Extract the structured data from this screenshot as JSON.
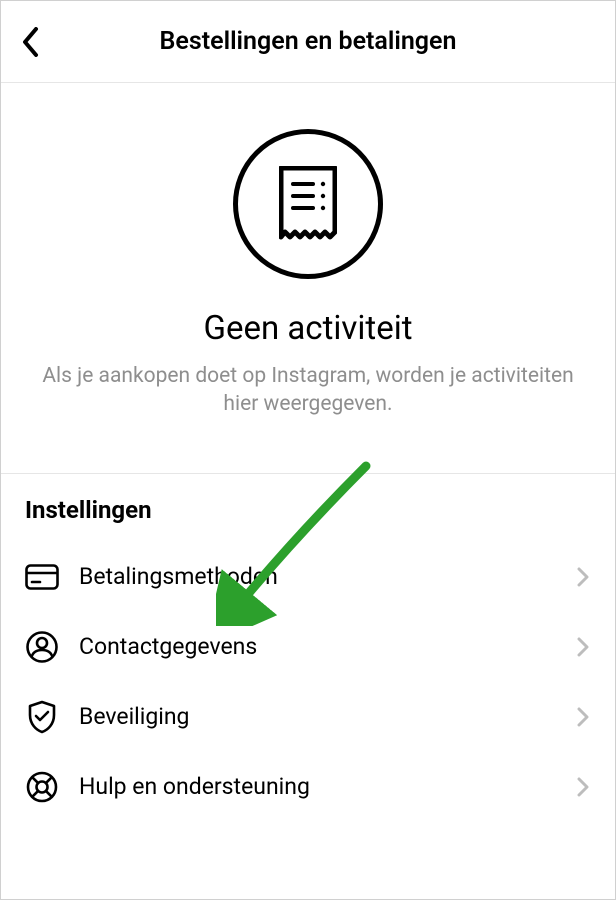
{
  "header": {
    "title": "Bestellingen en betalingen"
  },
  "empty_state": {
    "title": "Geen activiteit",
    "description": "Als je aankopen doet op Instagram, worden je activiteiten hier weergegeven."
  },
  "settings": {
    "title": "Instellingen",
    "items": [
      {
        "icon": "card-icon",
        "label": "Betalingsmethoden"
      },
      {
        "icon": "contact-icon",
        "label": "Contactgegevens"
      },
      {
        "icon": "shield-check-icon",
        "label": "Beveiliging"
      },
      {
        "icon": "lifebuoy-icon",
        "label": "Hulp en ondersteuning"
      }
    ]
  },
  "annotation": {
    "arrow_points_to": "Betalingsmethoden",
    "arrow_color": "#2ca02c"
  }
}
